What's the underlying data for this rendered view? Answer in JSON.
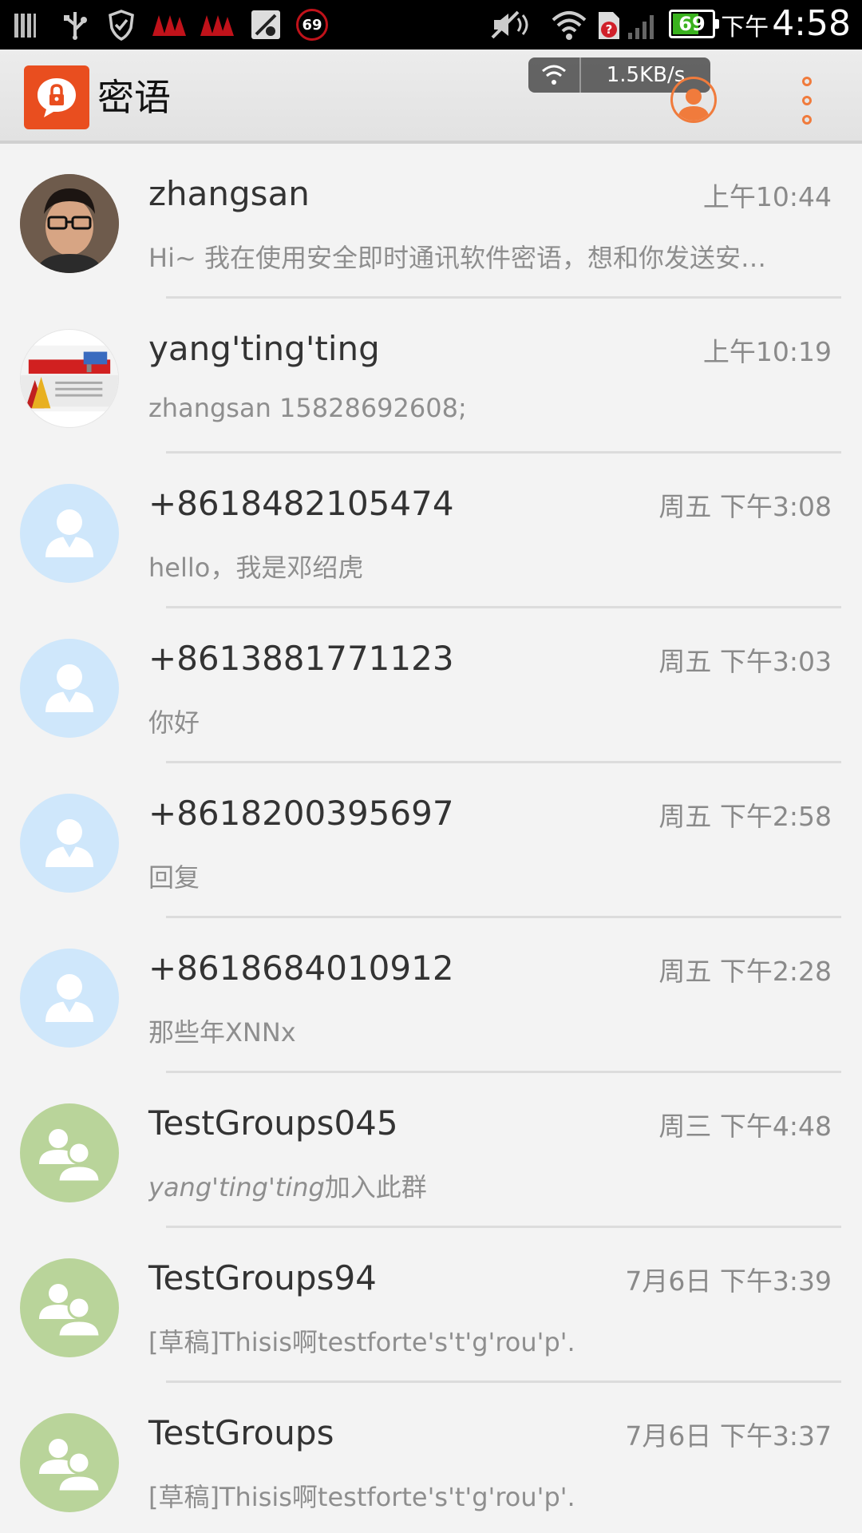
{
  "status_bar": {
    "ampm": "下午",
    "clock": "4:58",
    "battery_level": "69",
    "battery_fraction": 0.69,
    "notification_count": "69",
    "icons": [
      "sim-bars-icon",
      "usb-icon",
      "shield-icon",
      "red-app-icon",
      "red-app-icon",
      "muted-app-icon",
      "count-badge-icon",
      "mute-icon",
      "wifi-icon",
      "sim-error-icon",
      "signal-icon"
    ]
  },
  "app_bar": {
    "title": "密语",
    "logo_icon": "lock-chat-icon",
    "net_speed": "1.5KB/s",
    "accent_color": "#f07b3c",
    "logo_color": "#e94e1f"
  },
  "conversations": [
    {
      "name": "zhangsan",
      "time": "上午10:44",
      "preview": "Hi~ 我在使用安全即时通讯软件密语，想和你发送安…",
      "avatar": "photo-zs"
    },
    {
      "name": "yang'ting'ting",
      "time": "上午10:19",
      "preview": "zhangsan 15828692608;",
      "avatar": "photo-ytt"
    },
    {
      "name": "+8618482105474",
      "time": "周五 下午3:08",
      "preview": "hello，我是邓绍虎",
      "avatar": "person"
    },
    {
      "name": "+8613881771123",
      "time": "周五 下午3:03",
      "preview": "你好",
      "avatar": "person"
    },
    {
      "name": "+8618200395697",
      "time": "周五 下午2:58",
      "preview": "回复",
      "avatar": "person"
    },
    {
      "name": "+8618684010912",
      "time": "周五 下午2:28",
      "preview": "那些年XNNx",
      "avatar": "person"
    },
    {
      "name": "TestGroups045",
      "time": "周三 下午4:48",
      "preview_italic": "yang'ting'ting",
      "preview": "加入此群",
      "avatar": "group"
    },
    {
      "name": "TestGroups94",
      "time": "7月6日 下午3:39",
      "preview": "[草稿]Thisis啊testforte's't'g'rou'p'.",
      "avatar": "group"
    },
    {
      "name": "TestGroups",
      "time": "7月6日 下午3:37",
      "preview": "[草稿]Thisis啊testforte's't'g'rou'p'.",
      "avatar": "group"
    }
  ]
}
